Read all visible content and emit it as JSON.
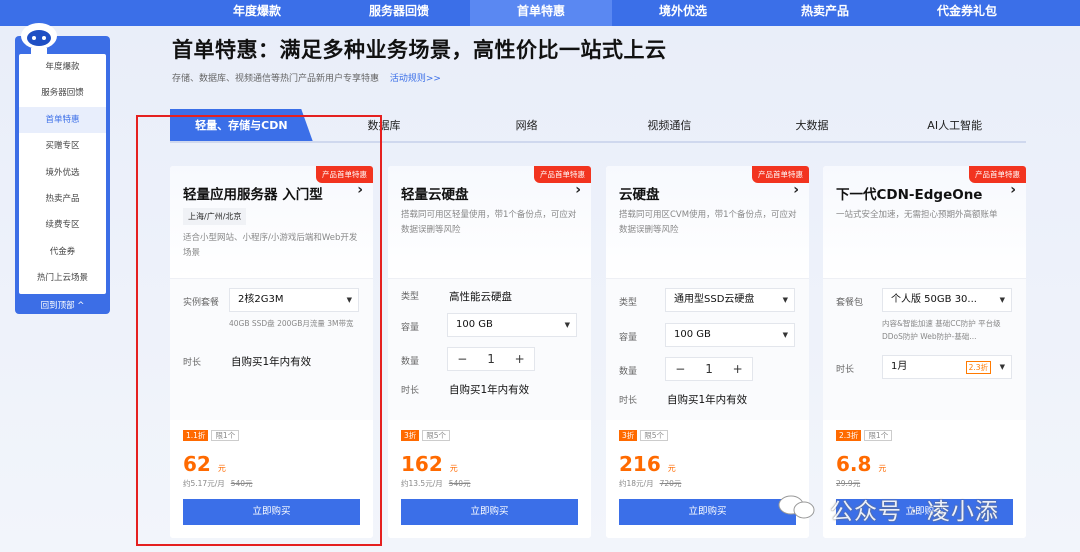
{
  "topnav": [
    "",
    "年度爆款",
    "服务器回馈",
    "首单特惠",
    "境外优选",
    "热卖产品",
    "代金券礼包"
  ],
  "sidebar": {
    "items": [
      "年度爆款",
      "服务器回馈",
      "首单特惠",
      "买赠专区",
      "境外优选",
      "热卖产品",
      "续费专区",
      "代金券",
      "热门上云场景"
    ],
    "back": "回到顶部 ^"
  },
  "header": {
    "title": "首单特惠：满足多种业务场景，高性价比一站式上云",
    "subtitle": "存储、数据库、视频通信等热门产品新用户专享特惠",
    "rule_link": "活动规则>>"
  },
  "tabs": [
    "轻量、存储与CDN",
    "数据库",
    "网络",
    "视频通信",
    "大数据",
    "AI人工智能"
  ],
  "cards": [
    {
      "ribbon": "产品首单特惠",
      "name": "轻量应用服务器 入门型",
      "region": "上海/广州/北京",
      "desc": "适合小型网站、小程序/小游戏后端和Web开发场景",
      "opt1_label": "实例套餐",
      "opt1_value": "2核2G3M",
      "opt1_note": "40GB SSD盘 200GB月流量 3M带宽",
      "dur_label": "时长",
      "dur_value": "自购买1年内有效",
      "discount": "1.1折",
      "limit": "限1个",
      "price": "62",
      "unit": "元",
      "per": "约5.17元/月",
      "orig": "540元",
      "buy": "立即购买"
    },
    {
      "ribbon": "产品首单特惠",
      "name": "轻量云硬盘",
      "desc": "搭载同可用区轻量使用，带1个备份点，可应对数据误删等风险",
      "type_label": "类型",
      "type_value": "高性能云硬盘",
      "cap_label": "容量",
      "cap_value": "100 GB",
      "qty_label": "数量",
      "qty": "1",
      "dur_label": "时长",
      "dur_value": "自购买1年内有效",
      "discount": "3折",
      "limit": "限5个",
      "price": "162",
      "unit": "元",
      "per": "约13.5元/月",
      "orig": "540元",
      "buy": "立即购买"
    },
    {
      "ribbon": "产品首单特惠",
      "name": "云硬盘",
      "desc": "搭载同可用区CVM使用，带1个备份点，可应对数据误删等风险",
      "type_label": "类型",
      "type_value": "通用型SSD云硬盘",
      "cap_label": "容量",
      "cap_value": "100 GB",
      "qty_label": "数量",
      "qty": "1",
      "dur_label": "时长",
      "dur_value": "自购买1年内有效",
      "discount": "3折",
      "limit": "限5个",
      "price": "216",
      "unit": "元",
      "per": "约18元/月",
      "orig": "720元",
      "buy": "立即购买"
    },
    {
      "ribbon": "产品首单特惠",
      "name": "下一代CDN-EdgeOne",
      "desc": "一站式安全加速，无需担心预期外高额账单",
      "pkg_label": "套餐包",
      "pkg_value": "个人版 50GB 30...",
      "pkg_note": "内容&智能加速 基础CC防护 平台级DDoS防护 Web防护-基础...",
      "dur_label": "时长",
      "dur_value": "1月",
      "dur_disc": "2.3折",
      "discount": "2.3折",
      "limit": "限1个",
      "price": "6.8",
      "unit": "元",
      "orig": "29.9元",
      "buy": "立即购买"
    }
  ],
  "watermark": "公众号 · 凌小添",
  "colors": {
    "brand": "#3b6fe8",
    "price": "#ff6a00",
    "ribbon": "#f2341f",
    "highlight_box": "#e5201f"
  }
}
